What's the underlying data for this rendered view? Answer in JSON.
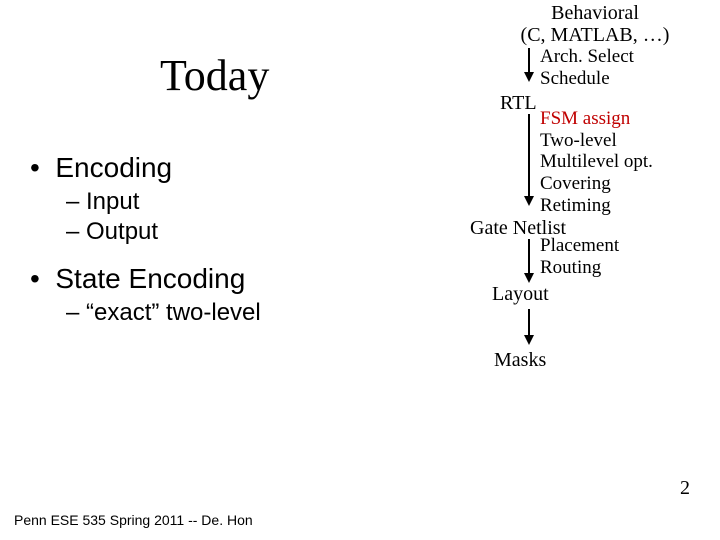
{
  "title": "Today",
  "bullets": {
    "b1": "Encoding",
    "b1a": "Input",
    "b1b": "Output",
    "b2": "State Encoding",
    "b2a": "“exact” two-level"
  },
  "flow": {
    "behavioral_l1": "Behavioral",
    "behavioral_l2": "(C, MATLAB, …)",
    "arch_l1": "Arch. Select",
    "arch_l2": "Schedule",
    "rtl": "RTL",
    "fsm": "FSM assign",
    "opt_l1": "Two-level",
    "opt_l2": "Multilevel opt.",
    "opt_l3": "Covering",
    "opt_l4": "Retiming",
    "gate": "Gate Netlist",
    "place_l1": "Placement",
    "place_l2": "Routing",
    "layout": "Layout",
    "masks": "Masks"
  },
  "footer": "Penn ESE 535 Spring 2011 -- De. Hon",
  "page": "2"
}
